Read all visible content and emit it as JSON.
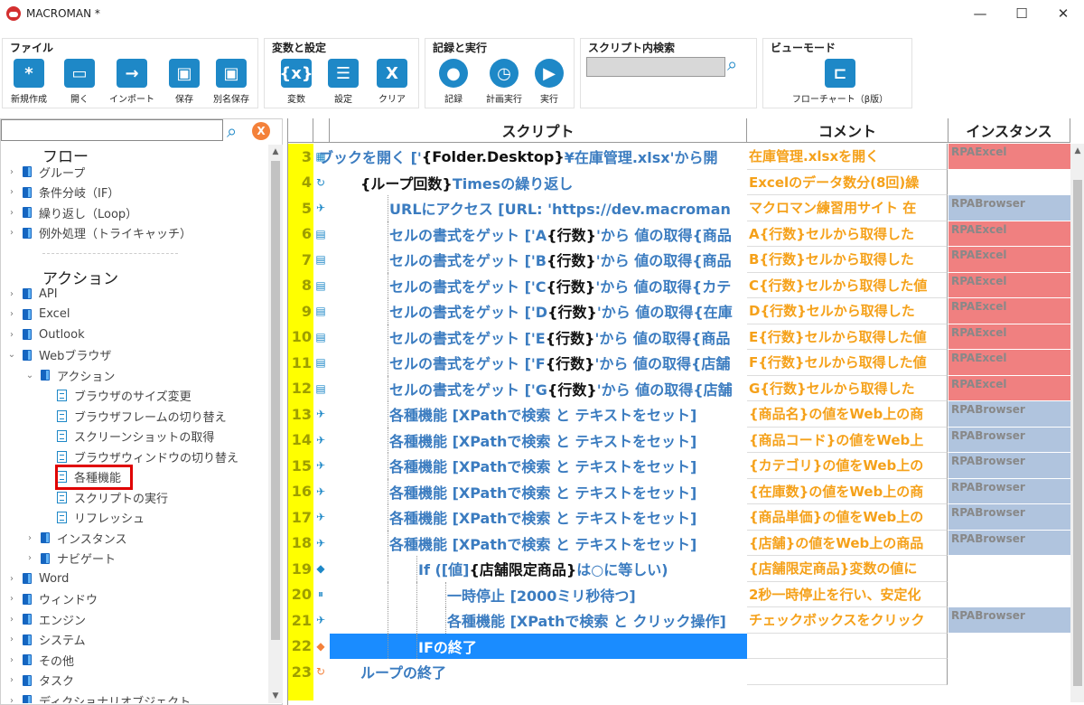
{
  "window": {
    "title": "MACROMAN *",
    "minimize": "—",
    "maximize": "☐",
    "close": "✕"
  },
  "ribbon": {
    "file": {
      "title": "ファイル",
      "buttons": [
        {
          "label": "新規作成",
          "glyph": "*"
        },
        {
          "label": "開く",
          "glyph": "▭"
        },
        {
          "label": "インポート",
          "glyph": "→"
        },
        {
          "label": "保存",
          "glyph": "▣"
        },
        {
          "label": "別名保存",
          "glyph": "▣"
        }
      ]
    },
    "variables": {
      "title": "変数と設定",
      "buttons": [
        {
          "label": "変数",
          "glyph": "{x}"
        },
        {
          "label": "設定",
          "glyph": "☰"
        },
        {
          "label": "クリア",
          "glyph": "X"
        }
      ]
    },
    "record": {
      "title": "記録と実行",
      "buttons": [
        {
          "label": "記録",
          "glyph": "●"
        },
        {
          "label": "計画実行",
          "glyph": "◷"
        },
        {
          "label": "実行",
          "glyph": "▶"
        }
      ]
    },
    "search": {
      "title": "スクリプト内検索",
      "value": ""
    },
    "view": {
      "title": "ビューモード",
      "buttons": [
        {
          "label": "フローチャート（β版）",
          "glyph": "⊏"
        }
      ]
    }
  },
  "tree": {
    "search_value": "",
    "clear_label": "X",
    "flow_header": "フロー",
    "action_header": "アクション",
    "flow_items": [
      "グループ",
      "条件分岐（IF）",
      "繰り返し（Loop）",
      "例外処理（トライキャッチ）"
    ],
    "action_items": [
      "API",
      "Excel",
      "Outlook",
      "Webブラウザ"
    ],
    "web_sub": "アクション",
    "web_actions": [
      "ブラウザのサイズ変更",
      "ブラウザフレームの切り替え",
      "スクリーンショットの取得",
      "ブラウザウィンドウの切り替え",
      "各種機能",
      "スクリプトの実行",
      "リフレッシュ"
    ],
    "web_more": [
      "インスタンス",
      "ナビゲート"
    ],
    "rest_items": [
      "Word",
      "ウィンドウ",
      "エンジン",
      "システム",
      "その他",
      "タスク",
      "ディクショナリオブジェクト"
    ]
  },
  "grid": {
    "headers": {
      "script": "スクリプト",
      "comment": "コメント",
      "instance": "インスタンス"
    },
    "rows": [
      {
        "num": "3",
        "icon": "▦",
        "indent": 0,
        "pre": "ブックを開く ['",
        "bold": "{Folder.Desktop}",
        "post": "¥在庫管理.xlsx'から開",
        "comment": "在庫管理.xlsxを開く",
        "instance": "RPAExcel",
        "inst_type": "excel"
      },
      {
        "num": "4",
        "icon": "↻",
        "indent": 1,
        "pre": "",
        "bold": "{ループ回数}",
        "post": " Timesの繰り返し",
        "comment": "Excelのデータ数分(8回)繰",
        "instance": "",
        "inst_type": ""
      },
      {
        "num": "5",
        "icon": "✈",
        "indent": 2,
        "pre": "URLにアクセス [URL: 'https://dev.macroman",
        "bold": "",
        "post": "",
        "comment": "マクロマン練習用サイト 在",
        "instance": "RPABrowser",
        "inst_type": "browser"
      },
      {
        "num": "6",
        "icon": "▤",
        "indent": 2,
        "pre": "セルの書式をゲット ['A",
        "bold": "{行数}",
        "post": "'から 値の取得{商品",
        "comment": "A{行数}セルから取得した",
        "instance": "RPAExcel",
        "inst_type": "excel"
      },
      {
        "num": "7",
        "icon": "▤",
        "indent": 2,
        "pre": "セルの書式をゲット ['B",
        "bold": "{行数}",
        "post": "'から 値の取得{商品",
        "comment": "B{行数}セルから取得した",
        "instance": "RPAExcel",
        "inst_type": "excel"
      },
      {
        "num": "8",
        "icon": "▤",
        "indent": 2,
        "pre": "セルの書式をゲット ['C",
        "bold": "{行数}",
        "post": "'から 値の取得{カテ",
        "comment": "C{行数}セルから取得した値",
        "instance": "RPAExcel",
        "inst_type": "excel"
      },
      {
        "num": "9",
        "icon": "▤",
        "indent": 2,
        "pre": "セルの書式をゲット ['D",
        "bold": "{行数}",
        "post": "'から 値の取得{在庫",
        "comment": "D{行数}セルから取得した",
        "instance": "RPAExcel",
        "inst_type": "excel"
      },
      {
        "num": "10",
        "icon": "▤",
        "indent": 2,
        "pre": "セルの書式をゲット ['E",
        "bold": "{行数}",
        "post": "'から 値の取得{商品",
        "comment": "E{行数}セルから取得した値",
        "instance": "RPAExcel",
        "inst_type": "excel"
      },
      {
        "num": "11",
        "icon": "▤",
        "indent": 2,
        "pre": "セルの書式をゲット ['F",
        "bold": "{行数}",
        "post": "'から 値の取得{店舗",
        "comment": "F{行数}セルから取得した値",
        "instance": "RPAExcel",
        "inst_type": "excel"
      },
      {
        "num": "12",
        "icon": "▤",
        "indent": 2,
        "pre": "セルの書式をゲット ['G",
        "bold": "{行数}",
        "post": "'から 値の取得{店舗",
        "comment": "G{行数}セルから取得した",
        "instance": "RPAExcel",
        "inst_type": "excel"
      },
      {
        "num": "13",
        "icon": "✈",
        "indent": 2,
        "pre": "各種機能 [XPathで検索 と テキストをセット]",
        "bold": "",
        "post": "",
        "comment": "{商品名}の値をWeb上の商",
        "instance": "RPABrowser",
        "inst_type": "browser"
      },
      {
        "num": "14",
        "icon": "✈",
        "indent": 2,
        "pre": "各種機能 [XPathで検索 と テキストをセット]",
        "bold": "",
        "post": "",
        "comment": "{商品コード}の値をWeb上",
        "instance": "RPABrowser",
        "inst_type": "browser"
      },
      {
        "num": "15",
        "icon": "✈",
        "indent": 2,
        "pre": "各種機能 [XPathで検索 と テキストをセット]",
        "bold": "",
        "post": "",
        "comment": "{カテゴリ}の値をWeb上の",
        "instance": "RPABrowser",
        "inst_type": "browser"
      },
      {
        "num": "16",
        "icon": "✈",
        "indent": 2,
        "pre": "各種機能 [XPathで検索 と テキストをセット]",
        "bold": "",
        "post": "",
        "comment": "{在庫数}の値をWeb上の商",
        "instance": "RPABrowser",
        "inst_type": "browser"
      },
      {
        "num": "17",
        "icon": "✈",
        "indent": 2,
        "pre": "各種機能 [XPathで検索 と テキストをセット]",
        "bold": "",
        "post": "",
        "comment": "{商品単価}の値をWeb上の",
        "instance": "RPABrowser",
        "inst_type": "browser"
      },
      {
        "num": "18",
        "icon": "✈",
        "indent": 2,
        "pre": "各種機能 [XPathで検索 と テキストをセット]",
        "bold": "",
        "post": "",
        "comment": "{店舗}の値をWeb上の商品",
        "instance": "RPABrowser",
        "inst_type": "browser"
      },
      {
        "num": "19",
        "icon": "◆",
        "indent": 3,
        "pre": "If ([値] ",
        "bold": "{店舗限定商品}",
        "post": "は○に等しい)",
        "comment": "{店舗限定商品}変数の値に",
        "instance": "",
        "inst_type": ""
      },
      {
        "num": "20",
        "icon": "⏸",
        "indent": 4,
        "pre": "一時停止 [2000ミリ秒待つ]",
        "bold": "",
        "post": "",
        "comment": "2秒一時停止を行い、安定化",
        "instance": "",
        "inst_type": ""
      },
      {
        "num": "21",
        "icon": "✈",
        "indent": 4,
        "pre": "各種機能 [XPathで検索 と クリック操作]",
        "bold": "",
        "post": "",
        "comment": "チェックボックスをクリック",
        "instance": "RPABrowser",
        "inst_type": "browser"
      },
      {
        "num": "22",
        "icon": "◆",
        "indent": 3,
        "pre": "IFの終了",
        "bold": "",
        "post": "",
        "comment": "",
        "instance": "",
        "inst_type": "",
        "selected": true
      },
      {
        "num": "23",
        "icon": "↻",
        "indent": 1,
        "pre": "ループの終了",
        "bold": "",
        "post": "",
        "comment": "",
        "instance": "",
        "inst_type": ""
      }
    ]
  }
}
